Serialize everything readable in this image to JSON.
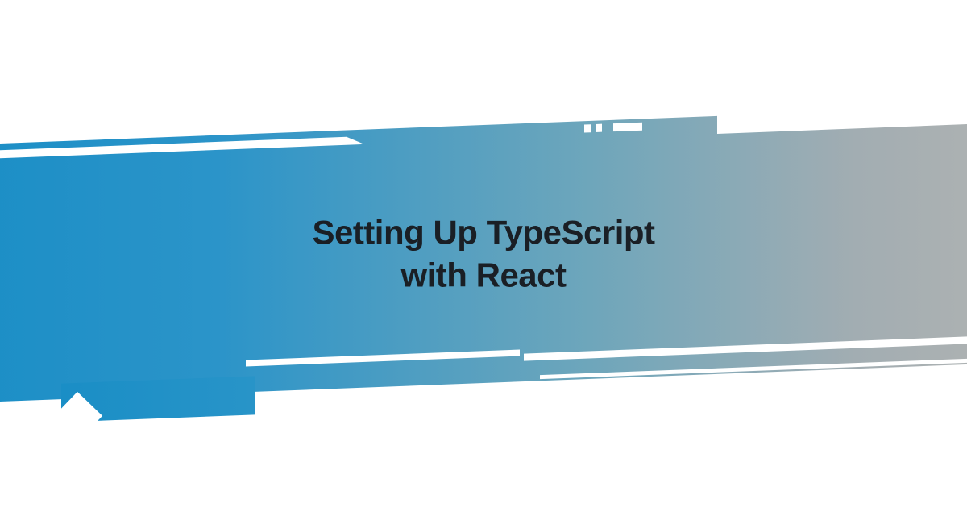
{
  "title": {
    "line1": "Setting Up TypeScript",
    "line2": "with React"
  }
}
